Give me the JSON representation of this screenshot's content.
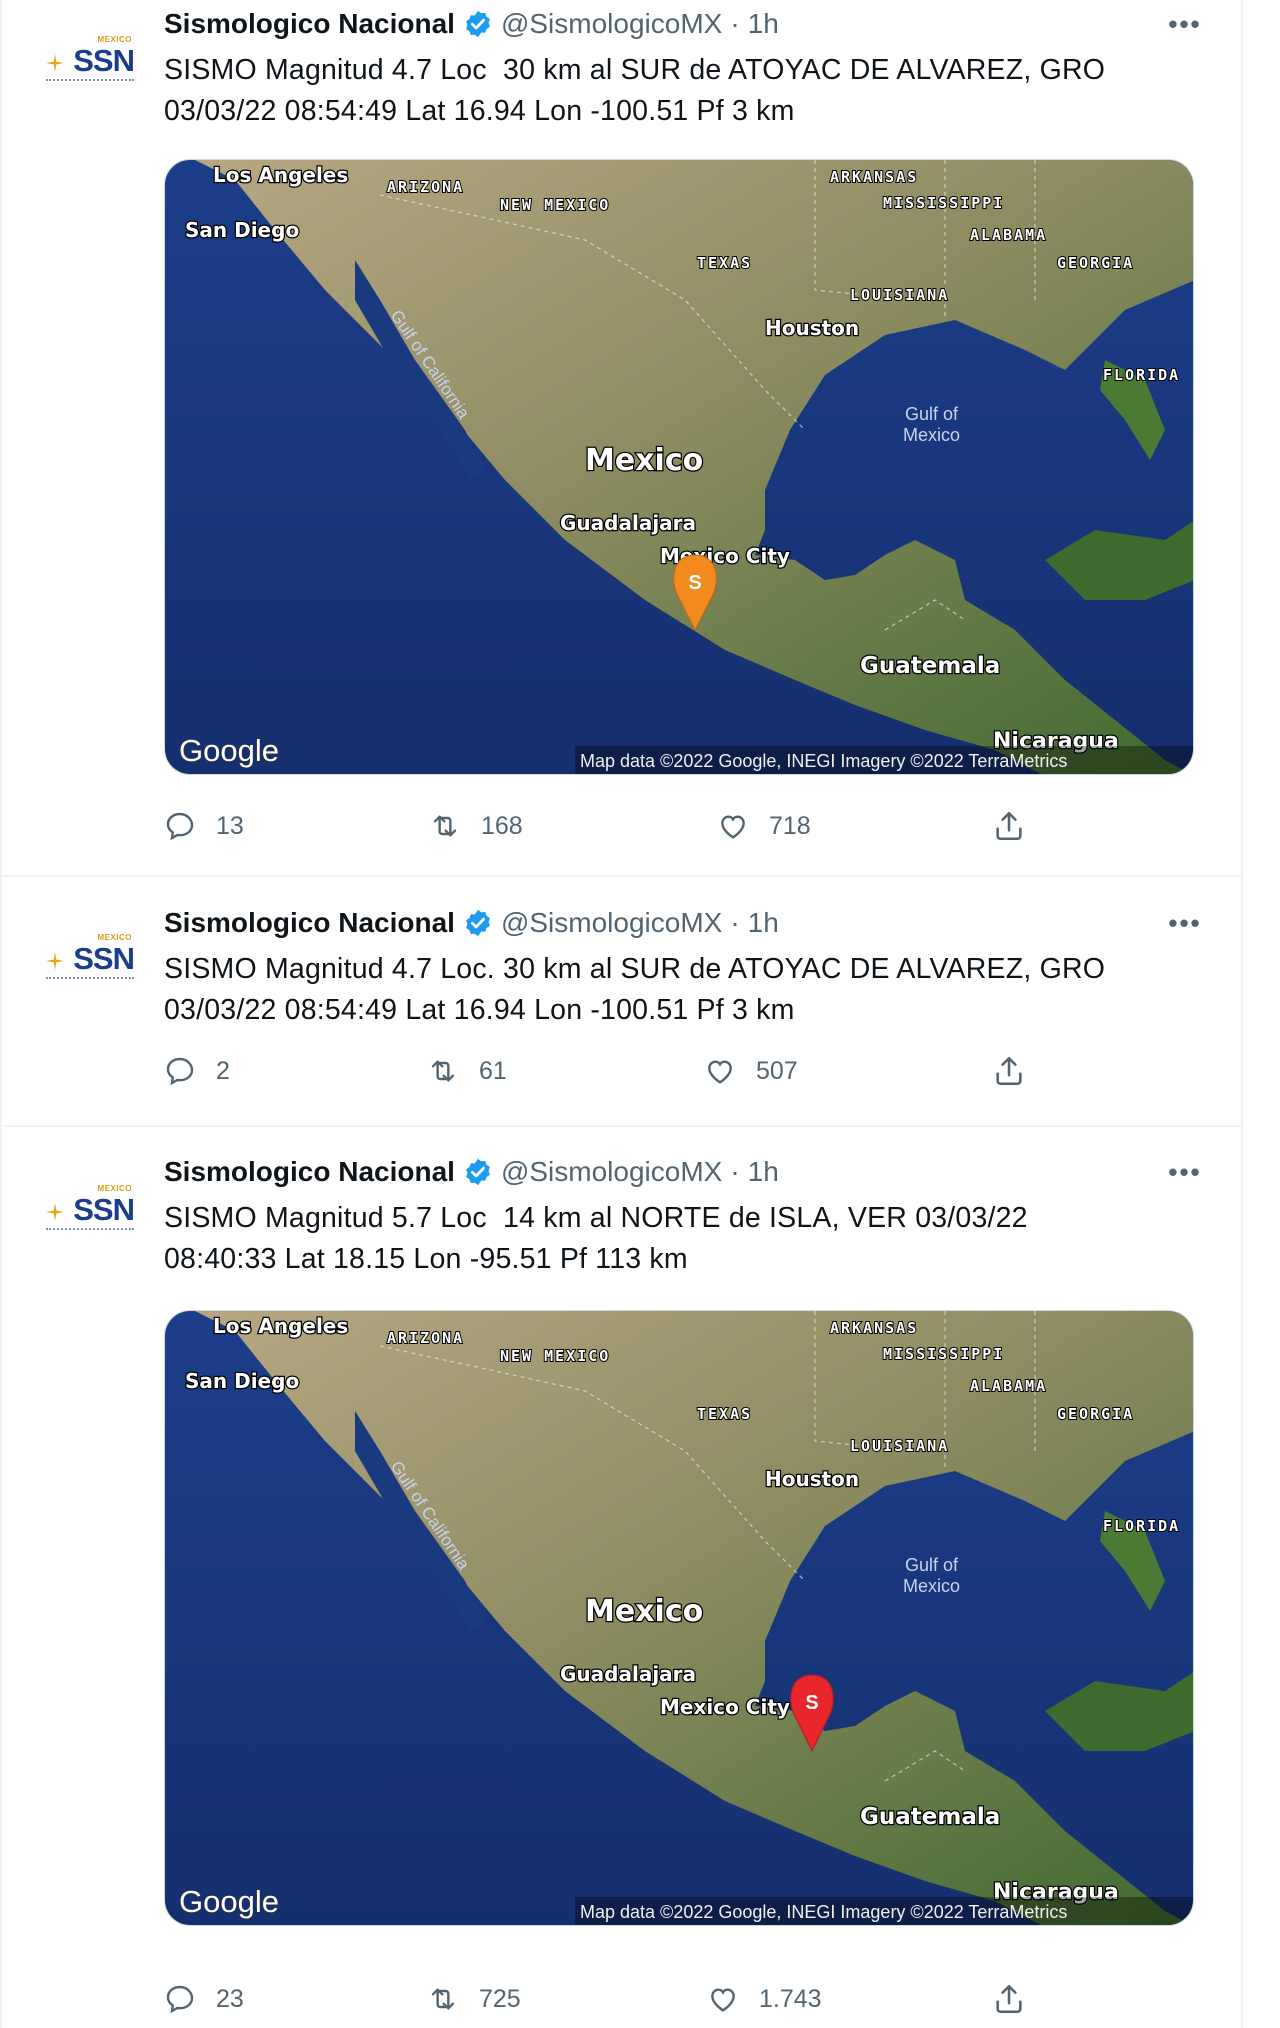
{
  "account": {
    "display_name": "Sismologico Nacional",
    "handle": "@SismologicoMX",
    "separator": "·",
    "avatar_mexico": "MEXICO",
    "avatar_text": "SSN"
  },
  "map_labels": {
    "los_angeles": "Los Angeles",
    "san_diego": "San Diego",
    "arizona": "ARIZONA",
    "new_mexico": "NEW MEXICO",
    "arkansas": "ARKANSAS",
    "mississippi": "MISSISSIPPI",
    "alabama": "ALABAMA",
    "georgia": "GEORGIA",
    "texas": "TEXAS",
    "louisiana": "LOUISIANA",
    "houston": "Houston",
    "florida": "FLORIDA",
    "gulf_of_california": "Gulf of California",
    "gulf_of_mexico_1": "Gulf of",
    "gulf_of_mexico_2": "Mexico",
    "mexico": "Mexico",
    "guadalajara": "Guadalajara",
    "mexico_city": "Mexico City",
    "guatemala": "Guatemala",
    "nicaragua": "Nicaragua",
    "google": "Google",
    "attribution": "Map data ©2022 Google, INEGI Imagery ©2022 TerraMetrics",
    "marker_letter": "S"
  },
  "tweets": [
    {
      "time": "1h",
      "text": "SISMO Magnitud 4.7 Loc  30 km al SUR de ATOYAC DE ALVAREZ, GRO\n03/03/22 08:54:49 Lat 16.94 Lon -100.51 Pf 3 km",
      "has_map": true,
      "marker_color": "#f28a1e",
      "replies": "13",
      "retweets": "168",
      "likes": "718"
    },
    {
      "time": "1h",
      "text": "SISMO Magnitud 4.7 Loc. 30 km al SUR de ATOYAC DE ALVAREZ, GRO\n03/03/22 08:54:49 Lat 16.94 Lon -100.51 Pf 3 km",
      "has_map": false,
      "replies": "2",
      "retweets": "61",
      "likes": "507"
    },
    {
      "time": "1h",
      "text": "SISMO Magnitud 5.7 Loc  14 km al NORTE de ISLA, VER 03/03/22\n08:40:33 Lat 18.15 Lon -95.51 Pf 113 km",
      "has_map": true,
      "marker_color": "#e8262b",
      "replies": "23",
      "retweets": "725",
      "likes": "1.743"
    }
  ]
}
